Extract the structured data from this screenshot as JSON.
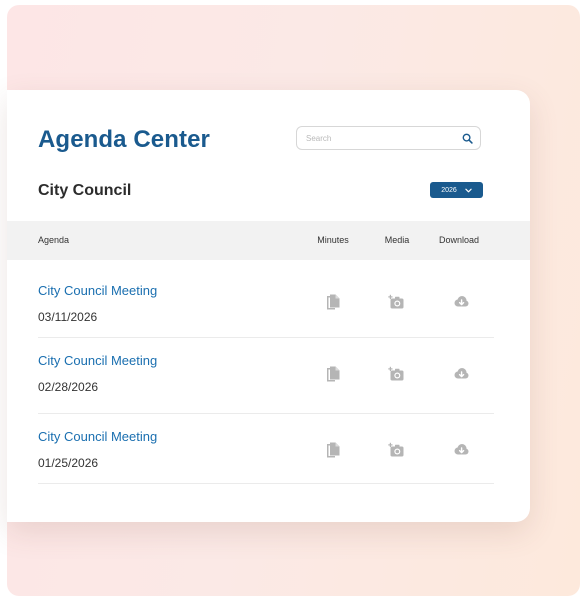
{
  "header": {
    "title": "Agenda Center"
  },
  "search": {
    "placeholder": "Search",
    "value": ""
  },
  "section": {
    "title": "City Council",
    "year": "2026"
  },
  "table": {
    "columns": {
      "agenda": "Agenda",
      "minutes": "Minutes",
      "media": "Media",
      "download": "Download"
    },
    "rows": [
      {
        "title": "City Council Meeting",
        "date": "03/11/2026"
      },
      {
        "title": "City Council Meeting",
        "date": "02/28/2026"
      },
      {
        "title": "City Council Meeting",
        "date": "01/25/2026"
      }
    ]
  },
  "icons": {
    "search": "search-icon",
    "year_dropdown": "chevron-down-icon",
    "minutes": "document-icon",
    "media": "camera-icon",
    "download": "cloud-download-icon"
  },
  "colors": {
    "brand": "#1a5a8e",
    "link": "#1a6fb0",
    "icon_gray": "#b5b5b5",
    "header_bg": "#f2f2f2"
  }
}
